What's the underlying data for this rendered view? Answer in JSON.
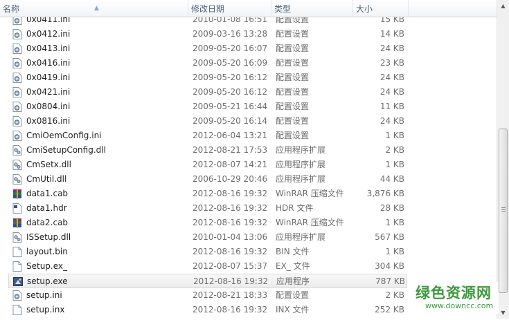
{
  "columns": {
    "name": "名称",
    "date": "修改日期",
    "type": "类型",
    "size": "大小"
  },
  "files": [
    {
      "name": "0x0411.ini",
      "date": "2010-01-08 16:51",
      "type": "配置设置",
      "size": "15 KB",
      "icon": "ini-settings-icon"
    },
    {
      "name": "0x0412.ini",
      "date": "2009-03-16 13:28",
      "type": "配置设置",
      "size": "14 KB",
      "icon": "ini-settings-icon"
    },
    {
      "name": "0x0413.ini",
      "date": "2009-05-20 16:07",
      "type": "配置设置",
      "size": "24 KB",
      "icon": "ini-settings-icon"
    },
    {
      "name": "0x0416.ini",
      "date": "2009-05-20 16:09",
      "type": "配置设置",
      "size": "23 KB",
      "icon": "ini-settings-icon"
    },
    {
      "name": "0x0419.ini",
      "date": "2009-05-20 16:12",
      "type": "配置设置",
      "size": "24 KB",
      "icon": "ini-settings-icon"
    },
    {
      "name": "0x0421.ini",
      "date": "2009-05-20 16:12",
      "type": "配置设置",
      "size": "24 KB",
      "icon": "ini-settings-icon"
    },
    {
      "name": "0x0804.ini",
      "date": "2009-05-21 16:44",
      "type": "配置设置",
      "size": "11 KB",
      "icon": "ini-settings-icon"
    },
    {
      "name": "0x0816.ini",
      "date": "2009-05-20 16:14",
      "type": "配置设置",
      "size": "24 KB",
      "icon": "ini-settings-icon"
    },
    {
      "name": "CmiOemConfig.ini",
      "date": "2012-06-04 13:21",
      "type": "配置设置",
      "size": "1 KB",
      "icon": "ini-settings-icon"
    },
    {
      "name": "CmiSetupConfig.dll",
      "date": "2012-08-21 17:53",
      "type": "应用程序扩展",
      "size": "2 KB",
      "icon": "dll-file-icon"
    },
    {
      "name": "CmSetx.dll",
      "date": "2012-08-07 14:21",
      "type": "应用程序扩展",
      "size": "1 KB",
      "icon": "dll-file-icon"
    },
    {
      "name": "CmUtil.dll",
      "date": "2006-10-29 20:46",
      "type": "应用程序扩展",
      "size": "44 KB",
      "icon": "dll-file-icon"
    },
    {
      "name": "data1.cab",
      "date": "2012-08-16 19:32",
      "type": "WinRAR 压缩文件",
      "size": "3,876 KB",
      "icon": "winrar-archive-icon"
    },
    {
      "name": "data1.hdr",
      "date": "2012-08-16 19:32",
      "type": "HDR 文件",
      "size": "28 KB",
      "icon": "hdr-file-icon"
    },
    {
      "name": "data2.cab",
      "date": "2012-08-16 19:32",
      "type": "WinRAR 压缩文件",
      "size": "1 KB",
      "icon": "winrar-archive-icon"
    },
    {
      "name": "ISSetup.dll",
      "date": "2010-01-04 13:06",
      "type": "应用程序扩展",
      "size": "567 KB",
      "icon": "dll-file-icon"
    },
    {
      "name": "layout.bin",
      "date": "2012-08-16 19:32",
      "type": "BIN 文件",
      "size": "1 KB",
      "icon": "blank-file-icon"
    },
    {
      "name": "Setup.ex_",
      "date": "2012-08-07 15:37",
      "type": "EX_ 文件",
      "size": "304 KB",
      "icon": "blank-file-icon"
    },
    {
      "name": "setup.exe",
      "date": "2012-08-16 19:32",
      "type": "应用程序",
      "size": "787 KB",
      "icon": "setup-exe-icon",
      "hover": true
    },
    {
      "name": "setup.ini",
      "date": "2012-08-21 18:33",
      "type": "配置设置",
      "size": "2 KB",
      "icon": "ini-settings-icon"
    },
    {
      "name": "setup.inx",
      "date": "2012-08-16 19:32",
      "type": "INX 文件",
      "size": "252 KB",
      "icon": "blank-file-icon"
    }
  ],
  "watermark": {
    "cn": "绿色资源网",
    "en": "www.downcc.com",
    "color": "#3c9a3c"
  },
  "colors": {
    "header_text": "#4c607a",
    "secondary_text": "#6d6d6d"
  }
}
